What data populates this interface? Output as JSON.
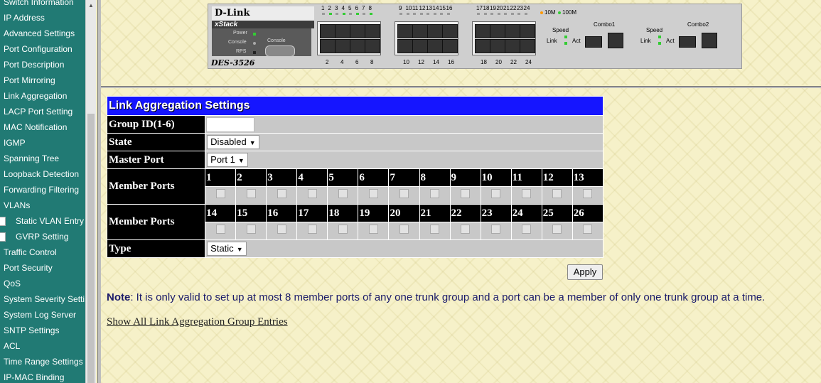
{
  "sidebar": {
    "items": [
      {
        "label": "Switch Information",
        "sub": false
      },
      {
        "label": "IP Address",
        "sub": false
      },
      {
        "label": "Advanced Settings",
        "sub": false
      },
      {
        "label": "Port Configuration",
        "sub": false
      },
      {
        "label": "Port Description",
        "sub": false
      },
      {
        "label": "Port Mirroring",
        "sub": false
      },
      {
        "label": "Link Aggregation",
        "sub": false
      },
      {
        "label": "LACP Port Setting",
        "sub": false
      },
      {
        "label": "MAC Notification",
        "sub": false
      },
      {
        "label": "IGMP",
        "sub": false
      },
      {
        "label": "Spanning Tree",
        "sub": false
      },
      {
        "label": "Loopback Detection",
        "sub": false
      },
      {
        "label": "Forwarding Filtering",
        "sub": false
      },
      {
        "label": "VLANs",
        "sub": false
      },
      {
        "label": "Static VLAN Entry",
        "sub": true
      },
      {
        "label": "GVRP Setting",
        "sub": true
      },
      {
        "label": "Traffic Control",
        "sub": false
      },
      {
        "label": "Port Security",
        "sub": false
      },
      {
        "label": "QoS",
        "sub": false
      },
      {
        "label": "System Severity Setti",
        "sub": false
      },
      {
        "label": "System Log Server",
        "sub": false
      },
      {
        "label": "SNTP Settings",
        "sub": false
      },
      {
        "label": "ACL",
        "sub": false
      },
      {
        "label": "Time Range Settings",
        "sub": false
      },
      {
        "label": "IP-MAC Binding",
        "sub": false
      }
    ]
  },
  "device": {
    "brand": "D-Link",
    "series": "xStack",
    "model": "DES-3526",
    "led_labels": [
      "Power",
      "Console",
      "RPS"
    ],
    "console_label": "Console",
    "top_numbers": [
      "1",
      "2",
      "3",
      "4",
      "5",
      "6",
      "7",
      "8",
      "9",
      "10",
      "11",
      "12",
      "13",
      "14",
      "15",
      "16",
      "17",
      "18",
      "19",
      "20",
      "21",
      "22",
      "23",
      "24"
    ],
    "bottom_numbers": [
      "2",
      "4",
      "6",
      "8",
      "10",
      "12",
      "14",
      "16",
      "18",
      "20",
      "22",
      "24"
    ],
    "speed_legend": [
      "10M",
      "100M"
    ],
    "combo_labels": [
      "Combo1",
      "Combo2"
    ],
    "combo_speed": "Speed",
    "combo_link": "Link",
    "combo_act": "Act",
    "colors": {
      "led_green": "#33cc33",
      "led_orange": "#ff9900"
    }
  },
  "form": {
    "title": "Link Aggregation Settings",
    "group_id_label": "Group ID(1-6)",
    "group_id_value": "",
    "state_label": "State",
    "state_value": "Disabled",
    "master_port_label": "Master Port",
    "master_port_value": "Port 1",
    "member_ports_label": "Member Ports",
    "ports_row1": [
      "1",
      "2",
      "3",
      "4",
      "5",
      "6",
      "7",
      "8",
      "9",
      "10",
      "11",
      "12",
      "13"
    ],
    "ports_row2": [
      "14",
      "15",
      "16",
      "17",
      "18",
      "19",
      "20",
      "21",
      "22",
      "23",
      "24",
      "25",
      "26"
    ],
    "type_label": "Type",
    "type_value": "Static",
    "apply_label": "Apply",
    "colors": {
      "title_bg": "#1515ff",
      "label_bg": "#000000",
      "value_bg": "#c8c8c8"
    }
  },
  "note": {
    "prefix": "Note",
    "text": ": It is only valid to set up at most 8 member ports of any one trunk group and a port can be a member of only one trunk group at a time."
  },
  "link": {
    "show_all": "Show All Link Aggregation Group Entries"
  }
}
